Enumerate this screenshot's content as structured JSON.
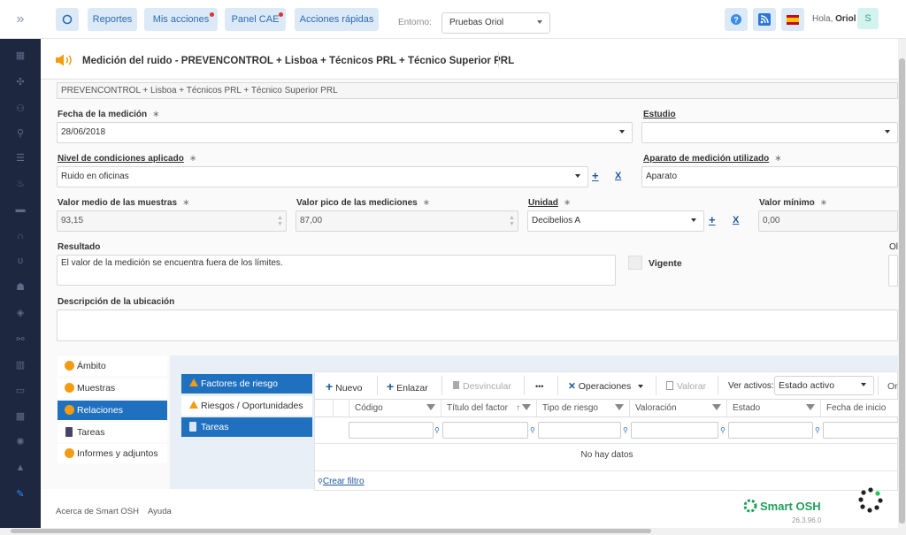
{
  "topbar": {
    "reportes": "Reportes",
    "mis_acciones": "Mis acciones",
    "panel_cae": "Panel CAE",
    "acciones_rapidas": "Acciones rápidas",
    "entorno_label": "Entorno:",
    "entorno_value": "Pruebas Oriol",
    "greeting_prefix": "Hola,",
    "user_name": "Oriol",
    "avatar_initial": "S"
  },
  "sidebar": {
    "icons": [
      "chart-icon",
      "compass-icon",
      "people-icon",
      "search-person-icon",
      "list-icon",
      "fire-icon",
      "book-icon",
      "headset-icon",
      "stethoscope-icon",
      "user-icon",
      "shield-icon",
      "org-icon",
      "building-icon",
      "briefcase-icon",
      "grid-icon",
      "virus-icon",
      "bell-icon",
      "ruler-icon"
    ]
  },
  "page": {
    "title": "Medición del ruido - PREVENCONTROL + Lisboa + Técnicos PRL + Técnico Superior PRL",
    "breadcrumb_field": "PREVENCONTROL + Lisboa + Técnicos PRL + Técnico Superior PRL"
  },
  "form": {
    "fecha_label": "Fecha de la medición",
    "fecha_value": "28/06/2018",
    "estudio_label": "Estudio",
    "estudio_value": "",
    "nivel_label": "Nivel de condiciones aplicado",
    "nivel_value": "Ruido en oficinas",
    "aparato_label": "Aparato de medición utilizado",
    "aparato_value": "Aparato",
    "valor_medio_label": "Valor medio de las muestras",
    "valor_medio_value": "93,15",
    "valor_pico_label": "Valor pico de las mediciones",
    "valor_pico_value": "87,00",
    "unidad_label": "Unidad",
    "unidad_value": "Decibelios A",
    "valor_minimo_label": "Valor mínimo",
    "valor_minimo_value": "0,00",
    "resultado_label": "Resultado",
    "resultado_value": "El valor de la medición se encuentra fuera de los límites.",
    "vigente_label": "Vigente",
    "ob_label": "Ol",
    "descripcion_label": "Descripción de la ubicación",
    "descripcion_value": "",
    "required_mark": "∗",
    "plus": "+",
    "x": "X"
  },
  "relnav": {
    "items": [
      "Ámbito",
      "Muestras",
      "Relaciones",
      "Tareas",
      "Informes y adjuntos"
    ]
  },
  "midnav": {
    "items": [
      "Factores de riesgo",
      "Riesgos / Oportunidades",
      "Tareas"
    ]
  },
  "grid": {
    "toolbar": {
      "nuevo": "Nuevo",
      "enlazar": "Enlazar",
      "desvincular": "Desvincular",
      "more": "•••",
      "operaciones": "Operaciones",
      "valorar": "Valorar",
      "ver_activos": "Ver activos:",
      "estado_activo": "Estado activo",
      "or": "Or"
    },
    "columns": [
      "Código",
      "Título del factor",
      "Tipo de riesgo",
      "Valoración",
      "Estado",
      "Fecha de inicio"
    ],
    "empty": "No hay datos",
    "crear_filtro": "Crear filtro"
  },
  "footer": {
    "about": "Acerca de Smart OSH",
    "help": "Ayuda",
    "brand": "Smart OSH",
    "version": "26.3.96.0"
  },
  "colors": {
    "accent": "#2070c0",
    "sidebar": "#1d2740",
    "brand_green": "#22a05a",
    "warning": "#f39c12"
  }
}
